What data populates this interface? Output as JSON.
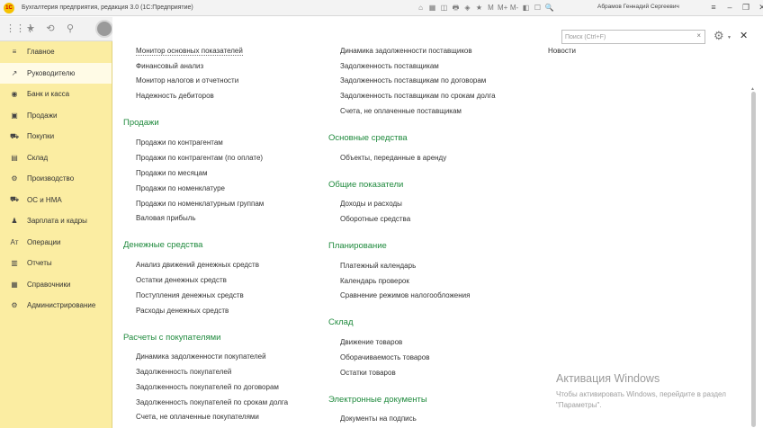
{
  "window": {
    "title": "Бухгалтерия предприятия, редакция 3.0 (1С:Предприятие)",
    "logo_text": "1С",
    "user": "Абрамов Геннадий Сергеевич",
    "tools": [
      "⌂",
      "▦",
      "◫",
      "🖶",
      "◈",
      "★",
      "M",
      "M+",
      "M-",
      "◧",
      "☐",
      "🔍"
    ],
    "controls": {
      "menu": "≡",
      "minimize": "–",
      "restore": "❐",
      "close": "✕"
    }
  },
  "toolbar": {
    "apps": "⋮⋮⋮",
    "favorites": "★",
    "history": "⟲",
    "search": "⚲"
  },
  "sidebar": {
    "items": [
      {
        "label": "Главное",
        "icon": "≡",
        "icon_name": "menu-icon"
      },
      {
        "label": "Руководителю",
        "icon": "↗",
        "icon_name": "trend-icon"
      },
      {
        "label": "Банк и касса",
        "icon": "◉",
        "icon_name": "bank-icon"
      },
      {
        "label": "Продажи",
        "icon": "▣",
        "icon_name": "bag-icon"
      },
      {
        "label": "Покупки",
        "icon": "⛟",
        "icon_name": "cart-icon"
      },
      {
        "label": "Склад",
        "icon": "▤",
        "icon_name": "warehouse-icon"
      },
      {
        "label": "Производство",
        "icon": "⚙",
        "icon_name": "factory-icon"
      },
      {
        "label": "ОС и НМА",
        "icon": "⛟",
        "icon_name": "truck-icon"
      },
      {
        "label": "Зарплата и кадры",
        "icon": "♟",
        "icon_name": "person-icon"
      },
      {
        "label": "Операции",
        "icon": "Aт",
        "icon_name": "operations-icon"
      },
      {
        "label": "Отчеты",
        "icon": "▥",
        "icon_name": "chart-icon"
      },
      {
        "label": "Справочники",
        "icon": "▦",
        "icon_name": "book-icon"
      },
      {
        "label": "Администрирование",
        "icon": "⚙",
        "icon_name": "gear-icon"
      }
    ]
  },
  "search": {
    "placeholder": "Поиск (Ctrl+F)",
    "value": "",
    "clear": "×"
  },
  "header_controls": {
    "gear": "⚙",
    "caret": "▼",
    "close": "✕"
  },
  "col1": {
    "top_links": [
      "Монитор основных показателей",
      "Финансовый анализ",
      "Монитор налогов и отчетности",
      "Надежность дебиторов"
    ],
    "sales_title": "Продажи",
    "sales_links": [
      "Продажи по контрагентам",
      "Продажи по контрагентам (по оплате)",
      "Продажи по месяцам",
      "Продажи по номенклатуре",
      "Продажи по номенклатурным группам",
      "Валовая прибыль"
    ],
    "cash_title": "Денежные средства",
    "cash_links": [
      "Анализ движений денежных средств",
      "Остатки денежных средств",
      "Поступления денежных средств",
      "Расходы денежных средств"
    ],
    "customers_title": "Расчеты с покупателями",
    "customers_links": [
      "Динамика задолженности покупателей",
      "Задолженность покупателей",
      "Задолженность покупателей по договорам",
      "Задолженность покупателей по срокам долга",
      "Счета, не оплаченные покупателями"
    ]
  },
  "col2": {
    "top_links": [
      "Динамика задолженности поставщиков",
      "Задолженность поставщикам",
      "Задолженность поставщикам по договорам",
      "Задолженность поставщикам по срокам долга",
      "Счета, не оплаченные поставщикам"
    ],
    "fixed_title": "Основные средства",
    "fixed_links": [
      "Объекты, переданные в аренду"
    ],
    "general_title": "Общие показатели",
    "general_links": [
      "Доходы и расходы",
      "Оборотные средства"
    ],
    "planning_title": "Планирование",
    "planning_links": [
      "Платежный календарь",
      "Календарь проверок",
      "Сравнение режимов налогообложения"
    ],
    "warehouse_title": "Склад",
    "warehouse_links": [
      "Движение товаров",
      "Оборачиваемость товаров",
      "Остатки товаров"
    ],
    "edocs_title": "Электронные документы",
    "edocs_links": [
      "Документы на подпись"
    ]
  },
  "col3": {
    "links": [
      "Новости"
    ]
  },
  "scroll": {
    "up": "▲"
  },
  "watermark": {
    "title": "Активация Windows",
    "text": "Чтобы активировать Windows, перейдите в раздел \"Параметры\"."
  }
}
